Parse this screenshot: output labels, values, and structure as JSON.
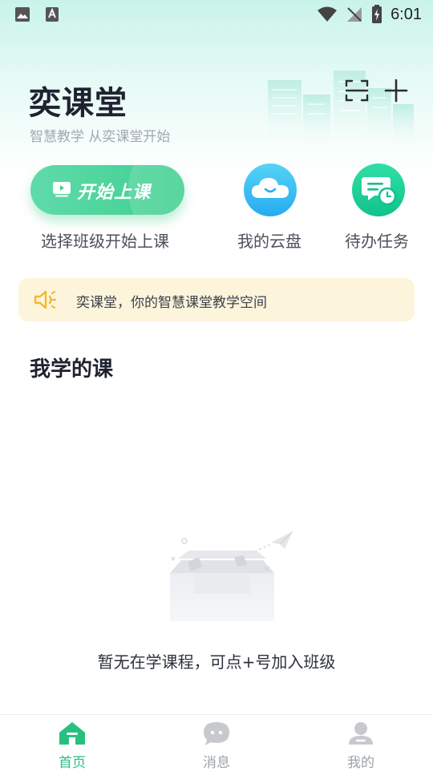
{
  "status_bar": {
    "time": "6:01"
  },
  "header": {
    "title": "奕课堂",
    "subtitle": "智慧教学 从奕课堂开始"
  },
  "quick_actions": {
    "start_button_label": "开始上课",
    "start_caption": "选择班级开始上课",
    "cloud_caption": "我的云盘",
    "todo_caption": "待办任务"
  },
  "notice": {
    "text": "奕课堂，你的智慧课堂教学空间"
  },
  "courses": {
    "section_title": "我学的课",
    "empty_text": "暂无在学课程，可点+号加入班级"
  },
  "tabbar": {
    "tabs": [
      {
        "label": "首页",
        "icon": "home-icon",
        "active": true
      },
      {
        "label": "消息",
        "icon": "message-icon",
        "active": false
      },
      {
        "label": "我的",
        "icon": "profile-icon",
        "active": false
      }
    ]
  },
  "colors": {
    "accent": "#27c07f",
    "notice_bg": "#fdf4dc",
    "cloud_blue": "#26abef",
    "todo_green": "#10c38a"
  }
}
